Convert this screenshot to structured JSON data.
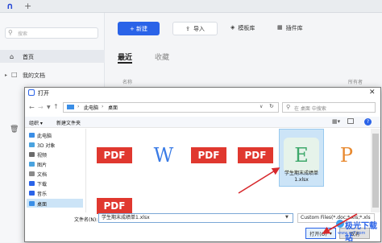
{
  "app": {
    "logo": "∩",
    "tab_plus": "+",
    "search_placeholder": "搜索",
    "nav_home": "首页",
    "nav_docs": "我的文档",
    "new_button": "+ 新建",
    "import_button": "导入",
    "template_button": "模板库",
    "plugin_button": "插件库",
    "tab_recent": "最近",
    "tab_favorites": "收藏",
    "col_name": "名称",
    "col_owner": "所有者"
  },
  "dialog": {
    "title": "打开",
    "close": "✕",
    "address": {
      "pc": "此电脑",
      "desktop": "桌面",
      "sep": "›"
    },
    "search_placeholder": "在 桌面 中搜索",
    "toolbar": {
      "organize": "组织 ▾",
      "new_folder": "新建文件夹",
      "help": "?"
    },
    "nav_items": [
      {
        "label": "此电脑",
        "color": "#3a8ee6"
      },
      {
        "label": "3D 对象",
        "color": "#4aa3df"
      },
      {
        "label": "视频",
        "color": "#6b6b6b"
      },
      {
        "label": "图片",
        "color": "#4aa3df"
      },
      {
        "label": "文档",
        "color": "#8a8a8a"
      },
      {
        "label": "下载",
        "color": "#2a63e8"
      },
      {
        "label": "音乐",
        "color": "#2a63e8"
      },
      {
        "label": "桌面",
        "color": "#3a8ee6"
      }
    ],
    "files": [
      {
        "kind": "pdf",
        "text": "PDF"
      },
      {
        "kind": "word",
        "text": "W"
      },
      {
        "kind": "pdf",
        "text": "PDF"
      },
      {
        "kind": "pdf",
        "text": "PDF"
      },
      {
        "kind": "excel",
        "text": "E",
        "label": "学生期末成绩单 1.xlsx"
      },
      {
        "kind": "ppt",
        "text": "P"
      },
      {
        "kind": "pdf",
        "text": "PDF"
      }
    ],
    "filename_label": "文件名(N):",
    "filename_value": "学生期末成绩单1.xlsx",
    "filetype_value": "Custom Files(*.doc;*.xls;*.xls",
    "open_button": "打开(O)",
    "cancel_button": "取消"
  },
  "watermark": {
    "main": "极光下载站",
    "sub": "www.xz7.com"
  },
  "colors": {
    "accent": "#2a63e8",
    "pdf": "#e0382f",
    "word": "#3b7ce6",
    "excel": "#3ea86b",
    "ppt": "#e8892f",
    "arrow": "#d7282c"
  }
}
